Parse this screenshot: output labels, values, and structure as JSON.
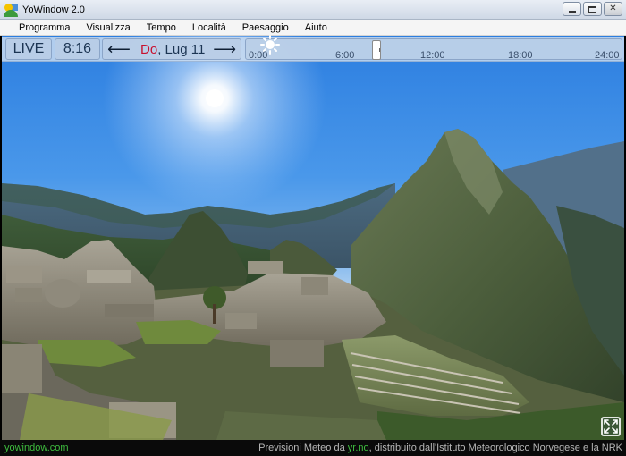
{
  "window": {
    "title": "YoWindow 2.0"
  },
  "menu": [
    {
      "label": "Programma"
    },
    {
      "label": "Visualizza"
    },
    {
      "label": "Tempo"
    },
    {
      "label": "Località"
    },
    {
      "label": "Paesaggio"
    },
    {
      "label": "Aiuto"
    }
  ],
  "controls": {
    "live_label": "LIVE",
    "time": "8:16",
    "date_dow": "Do",
    "date_rest": ", Lug 11",
    "prev_icon": "arrow-left-icon",
    "next_icon": "arrow-right-icon",
    "timeline_ticks": [
      "0:00",
      "6:00",
      "12:00",
      "18:00",
      "24:00"
    ],
    "weather_icon": "sun-icon"
  },
  "status": {
    "site": "yowindow.com",
    "credit_prefix": "Previsioni Meteo da ",
    "credit_source": "yr.no",
    "credit_suffix": ", distribuito dall'Istituto Meteorologico Norvegese e la NRK"
  },
  "colors": {
    "accent_green": "#3fbd3f",
    "dow_red": "#c8102e",
    "sky": "#2c7ee0"
  }
}
